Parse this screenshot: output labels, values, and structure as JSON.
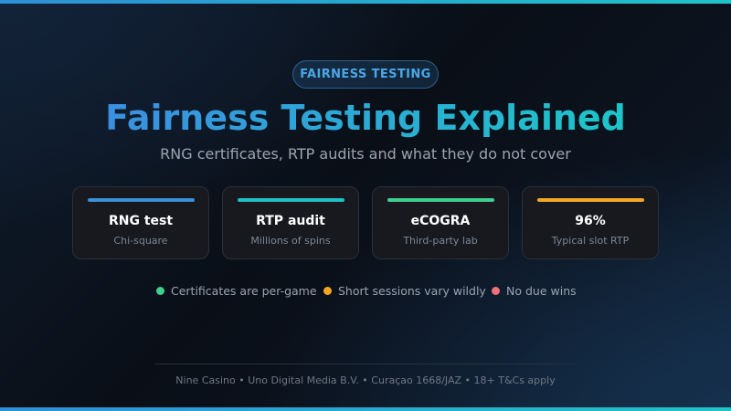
{
  "badge": "FAIRNESS TESTING",
  "title": "Fairness Testing Explained",
  "subtitle": "RNG certificates, RTP audits and what they do not cover",
  "cards": [
    {
      "title": "RNG test",
      "subtitle": "Chi-square",
      "accent": "#3a8fd9"
    },
    {
      "title": "RTP audit",
      "subtitle": "Millions of spins",
      "accent": "#1fbfc4"
    },
    {
      "title": "eCOGRA",
      "subtitle": "Third-party lab",
      "accent": "#3ecf8e"
    },
    {
      "title": "96%",
      "subtitle": "Typical slot RTP",
      "accent": "#f5a623"
    }
  ],
  "notes": [
    {
      "text": "Certificates are per-game",
      "color": "#3ecf8e"
    },
    {
      "text": "Short sessions vary wildly",
      "color": "#f5a623"
    },
    {
      "text": "No due wins",
      "color": "#f07178"
    }
  ],
  "footer": "Nine Casino • Uno Digital Media B.V. • Curaçao 1668/JAZ • 18+ T&Cs apply"
}
